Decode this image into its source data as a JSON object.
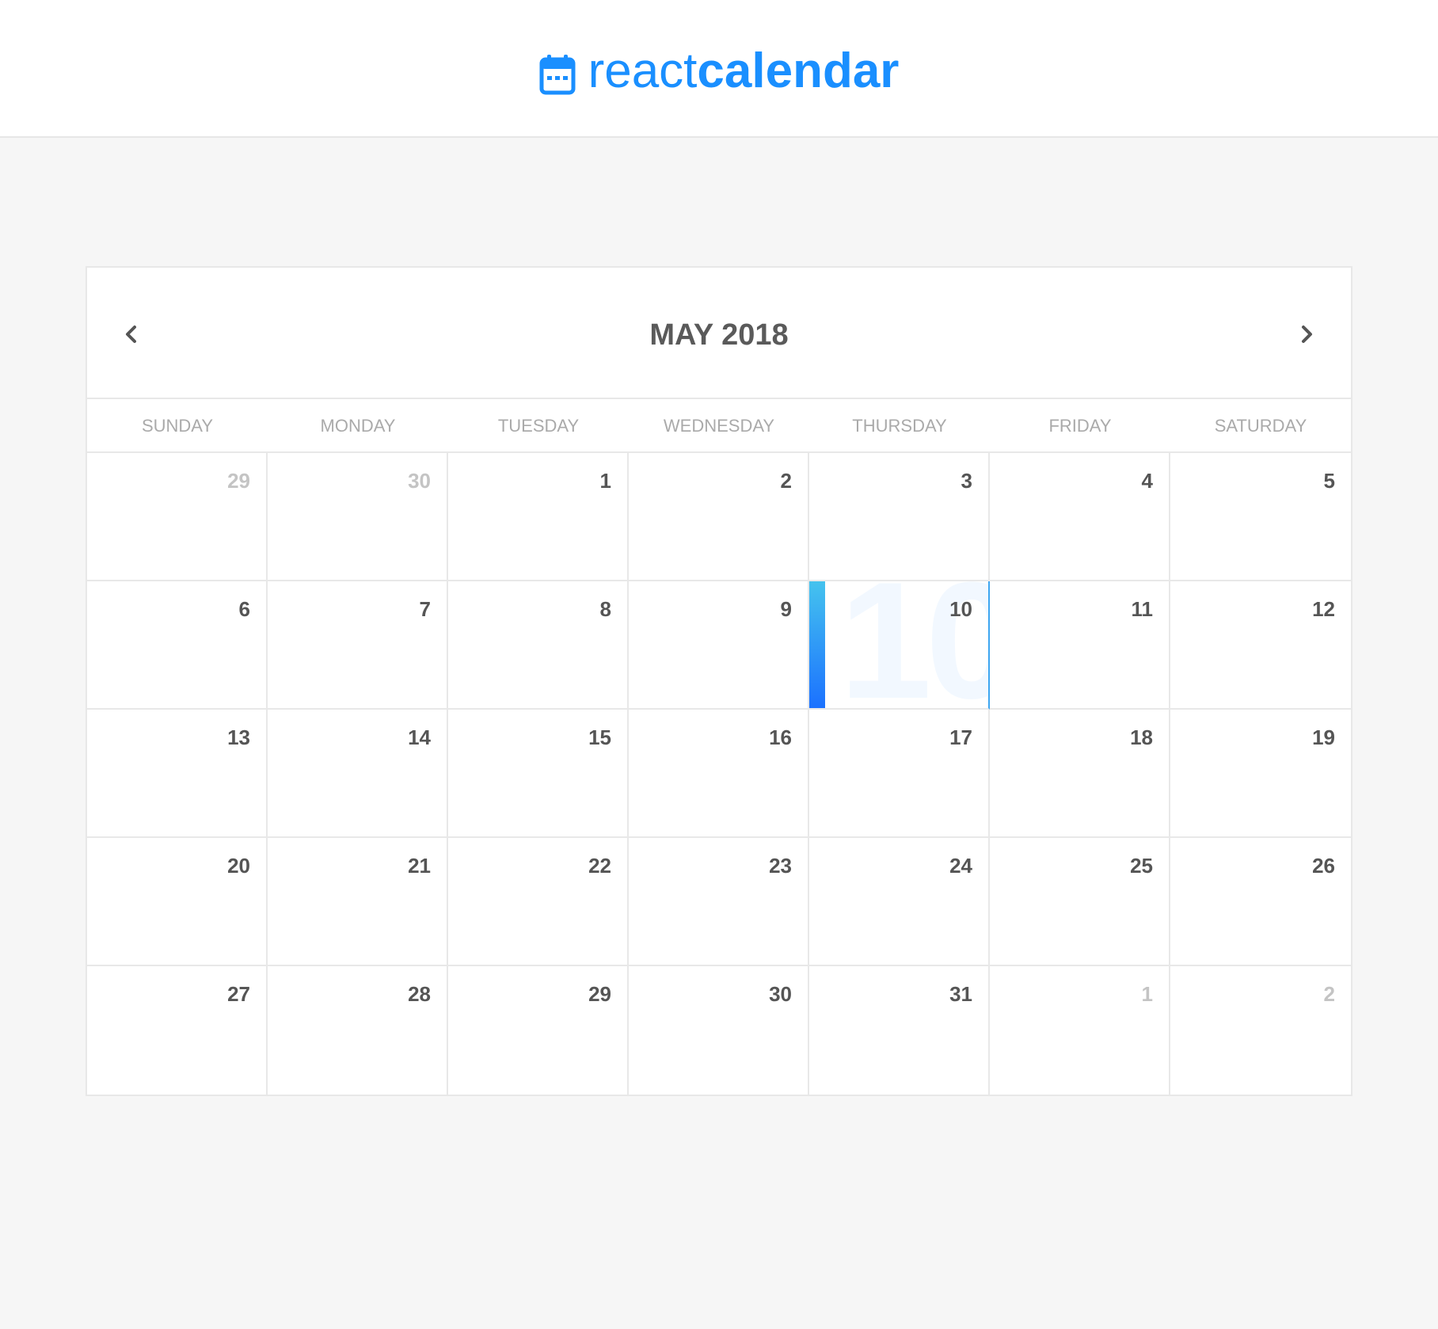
{
  "brand": {
    "icon": "calendar-icon",
    "text_light": "react",
    "text_bold": "calendar",
    "color": "#1a8fff"
  },
  "calendar": {
    "month_label": "MAY 2018",
    "prev_icon": "chevron-left-icon",
    "next_icon": "chevron-right-icon",
    "weekdays": [
      "SUNDAY",
      "MONDAY",
      "TUESDAY",
      "WEDNESDAY",
      "THURSDAY",
      "FRIDAY",
      "SATURDAY"
    ],
    "selected_day": "10",
    "accent_gradient": [
      "#45c3ee",
      "#1b71ff"
    ],
    "weeks": [
      [
        {
          "day": "29",
          "disabled": true
        },
        {
          "day": "30",
          "disabled": true
        },
        {
          "day": "1"
        },
        {
          "day": "2"
        },
        {
          "day": "3"
        },
        {
          "day": "4"
        },
        {
          "day": "5"
        }
      ],
      [
        {
          "day": "6"
        },
        {
          "day": "7"
        },
        {
          "day": "8"
        },
        {
          "day": "9"
        },
        {
          "day": "10",
          "selected": true
        },
        {
          "day": "11"
        },
        {
          "day": "12"
        }
      ],
      [
        {
          "day": "13"
        },
        {
          "day": "14"
        },
        {
          "day": "15"
        },
        {
          "day": "16"
        },
        {
          "day": "17"
        },
        {
          "day": "18"
        },
        {
          "day": "19"
        }
      ],
      [
        {
          "day": "20"
        },
        {
          "day": "21"
        },
        {
          "day": "22"
        },
        {
          "day": "23"
        },
        {
          "day": "24"
        },
        {
          "day": "25"
        },
        {
          "day": "26"
        }
      ],
      [
        {
          "day": "27"
        },
        {
          "day": "28"
        },
        {
          "day": "29"
        },
        {
          "day": "30"
        },
        {
          "day": "31"
        },
        {
          "day": "1",
          "disabled": true
        },
        {
          "day": "2",
          "disabled": true
        }
      ]
    ]
  }
}
